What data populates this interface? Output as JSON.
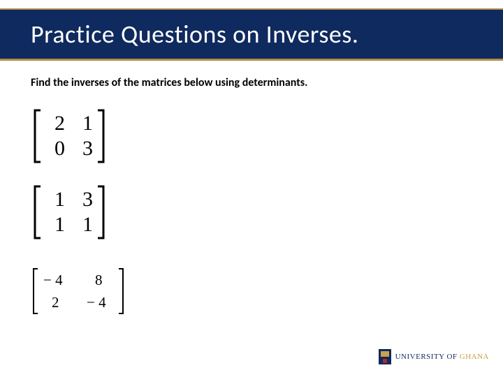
{
  "title": "Practice Questions on Inverses.",
  "instruction": "Find the inverses of the matrices below using determinants.",
  "matrices": [
    {
      "rows": [
        [
          "2",
          "1"
        ],
        [
          "0",
          "3"
        ]
      ],
      "size": "large"
    },
    {
      "rows": [
        [
          "1",
          "3"
        ],
        [
          "1",
          "1"
        ]
      ],
      "size": "large"
    },
    {
      "rows": [
        [
          "− 4",
          "8"
        ],
        [
          "2",
          "− 4"
        ]
      ],
      "size": "small"
    }
  ],
  "footer": {
    "org_prefix": "UNIVERSITY OF ",
    "org_name": "GHANA"
  }
}
